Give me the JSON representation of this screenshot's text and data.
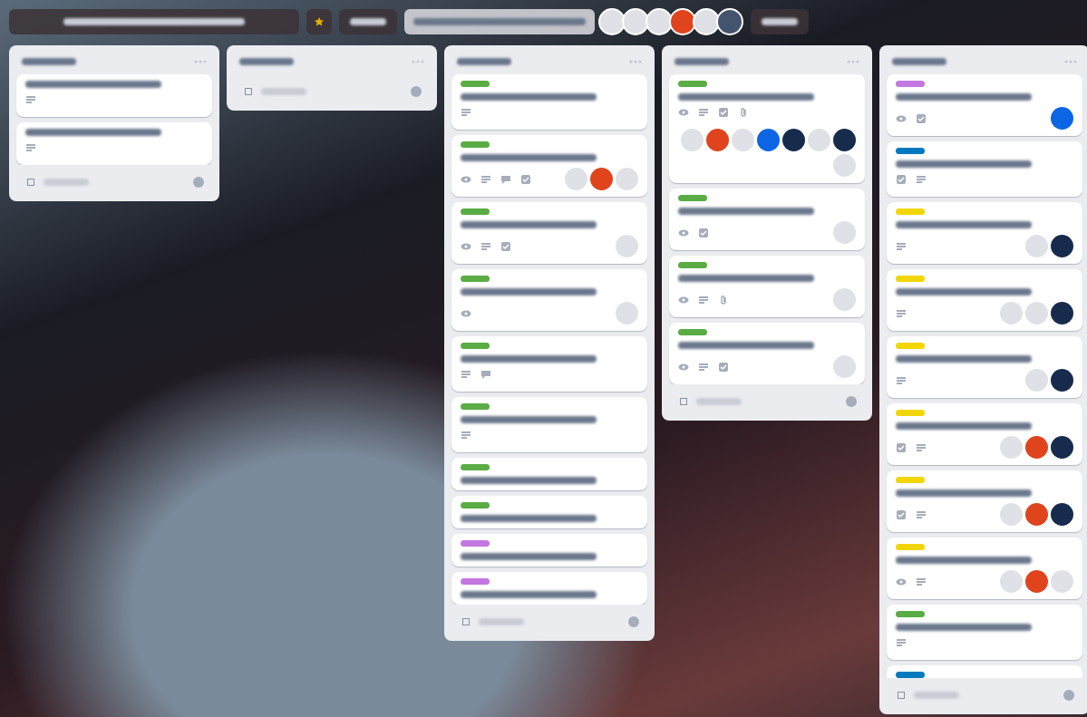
{
  "topbar": {
    "members": [
      {
        "color": "#dfe1e6"
      },
      {
        "color": "#dfe1e6"
      },
      {
        "color": "#dfe1e6"
      },
      {
        "color": "#e0441c"
      },
      {
        "color": "#dfe1e6"
      },
      {
        "color": "#44546f"
      }
    ]
  },
  "lists": [
    {
      "kind": "list",
      "cards": [
        {
          "badges": [
            {
              "kind": "description"
            }
          ]
        },
        {
          "badges": [
            {
              "kind": "description"
            }
          ]
        }
      ]
    },
    {
      "kind": "list"
    },
    {
      "kind": "list",
      "cards": [
        {
          "label": {
            "color": "#5aac44"
          },
          "badges": [
            {
              "kind": "description"
            }
          ]
        },
        {
          "label": {
            "color": "#5aac44"
          },
          "badges": [
            {
              "kind": "watch"
            },
            {
              "kind": "description"
            },
            {
              "kind": "comment"
            },
            {
              "kind": "checklist"
            }
          ],
          "members": [
            {
              "color": "#dfe1e6"
            },
            {
              "color": "#e0441c"
            },
            {
              "color": "#dfe1e6"
            }
          ]
        },
        {
          "label": {
            "color": "#5aac44"
          },
          "badges": [
            {
              "kind": "watch"
            },
            {
              "kind": "description"
            },
            {
              "kind": "checklist"
            }
          ],
          "members": [
            {
              "color": "#dfe1e6"
            }
          ]
        },
        {
          "label": {
            "color": "#5aac44"
          },
          "badges": [
            {
              "kind": "watch"
            }
          ],
          "members": [
            {
              "color": "#dfe1e6"
            }
          ]
        },
        {
          "label": {
            "color": "#5aac44"
          },
          "badges": [
            {
              "kind": "description"
            },
            {
              "kind": "comment"
            }
          ]
        },
        {
          "label": {
            "color": "#5aac44"
          },
          "badges": [
            {
              "kind": "description"
            }
          ]
        },
        {
          "label": {
            "color": "#5aac44"
          }
        },
        {
          "label": {
            "color": "#5aac44"
          }
        },
        {
          "label": {
            "color": "#c377e0"
          }
        },
        {
          "label": {
            "color": "#c377e0"
          }
        }
      ]
    },
    {
      "kind": "list",
      "cards": [
        {
          "label": {
            "color": "#5aac44"
          },
          "badges": [
            {
              "kind": "watch"
            },
            {
              "kind": "description"
            },
            {
              "kind": "checklist"
            },
            {
              "kind": "attachment"
            }
          ],
          "members": [
            {
              "color": "#dfe1e6"
            },
            {
              "color": "#e0441c"
            },
            {
              "color": "#dfe1e6"
            },
            {
              "color": "#0c66e4"
            },
            {
              "color": "#172b4d"
            },
            {
              "color": "#dfe1e6"
            },
            {
              "color": "#172b4d"
            },
            {
              "color": "#dfe1e6"
            }
          ]
        },
        {
          "label": {
            "color": "#5aac44"
          },
          "badges": [
            {
              "kind": "watch"
            },
            {
              "kind": "checklist"
            }
          ],
          "members": [
            {
              "color": "#dfe1e6"
            }
          ]
        },
        {
          "label": {
            "color": "#5aac44"
          },
          "badges": [
            {
              "kind": "watch"
            },
            {
              "kind": "description"
            },
            {
              "kind": "attachment"
            }
          ],
          "members": [
            {
              "color": "#dfe1e6"
            }
          ]
        },
        {
          "label": {
            "color": "#5aac44"
          },
          "badges": [
            {
              "kind": "watch"
            },
            {
              "kind": "description"
            },
            {
              "kind": "checklist"
            }
          ],
          "members": [
            {
              "color": "#dfe1e6"
            }
          ]
        }
      ]
    },
    {
      "kind": "list",
      "cards": [
        {
          "label": {
            "color": "#c377e0"
          },
          "badges": [
            {
              "kind": "watch"
            },
            {
              "kind": "checklist"
            }
          ],
          "members": [
            {
              "color": "#0c66e4"
            }
          ]
        },
        {
          "label": {
            "color": "#0079bf"
          },
          "badges": [
            {
              "kind": "checklist"
            },
            {
              "kind": "description"
            }
          ]
        },
        {
          "label": {
            "color": "#f2d600"
          },
          "badges": [
            {
              "kind": "description"
            }
          ],
          "members": [
            {
              "color": "#dfe1e6"
            },
            {
              "color": "#172b4d"
            }
          ]
        },
        {
          "label": {
            "color": "#f2d600"
          },
          "badges": [
            {
              "kind": "description"
            }
          ],
          "members": [
            {
              "color": "#dfe1e6"
            },
            {
              "color": "#dfe1e6"
            },
            {
              "color": "#172b4d"
            }
          ]
        },
        {
          "label": {
            "color": "#f2d600"
          },
          "badges": [
            {
              "kind": "description"
            }
          ],
          "members": [
            {
              "color": "#dfe1e6"
            },
            {
              "color": "#172b4d"
            }
          ]
        },
        {
          "label": {
            "color": "#f2d600"
          },
          "badges": [
            {
              "kind": "checklist"
            },
            {
              "kind": "description"
            }
          ],
          "members": [
            {
              "color": "#dfe1e6"
            },
            {
              "color": "#e0441c"
            },
            {
              "color": "#172b4d"
            }
          ]
        },
        {
          "label": {
            "color": "#f2d600"
          },
          "badges": [
            {
              "kind": "checklist"
            },
            {
              "kind": "description"
            }
          ],
          "members": [
            {
              "color": "#dfe1e6"
            },
            {
              "color": "#e0441c"
            },
            {
              "color": "#172b4d"
            }
          ]
        },
        {
          "label": {
            "color": "#f2d600"
          },
          "badges": [
            {
              "kind": "watch"
            },
            {
              "kind": "description"
            }
          ],
          "members": [
            {
              "color": "#dfe1e6"
            },
            {
              "color": "#e0441c"
            },
            {
              "color": "#dfe1e6"
            }
          ]
        },
        {
          "label": {
            "color": "#5aac44"
          },
          "badges": [
            {
              "kind": "description"
            }
          ]
        },
        {
          "label": {
            "color": "#0079bf"
          }
        }
      ]
    }
  ]
}
